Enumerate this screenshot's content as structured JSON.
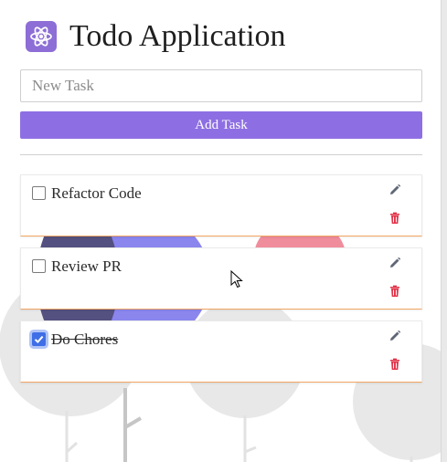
{
  "app": {
    "title": "Todo Application",
    "logo_icon": "atom-icon"
  },
  "new_task": {
    "placeholder": "New Task",
    "value": ""
  },
  "add_button": {
    "label": "Add Task"
  },
  "todos": [
    {
      "label": "Refactor Code",
      "done": false
    },
    {
      "label": "Review PR",
      "done": false
    },
    {
      "label": "Do Chores",
      "done": true
    }
  ],
  "colors": {
    "accent": "#8e6fe3",
    "card_border": "#f2a663",
    "delete": "#e2344a",
    "edit": "#5f6777",
    "checkbox_checked": "#3f6fe6"
  }
}
